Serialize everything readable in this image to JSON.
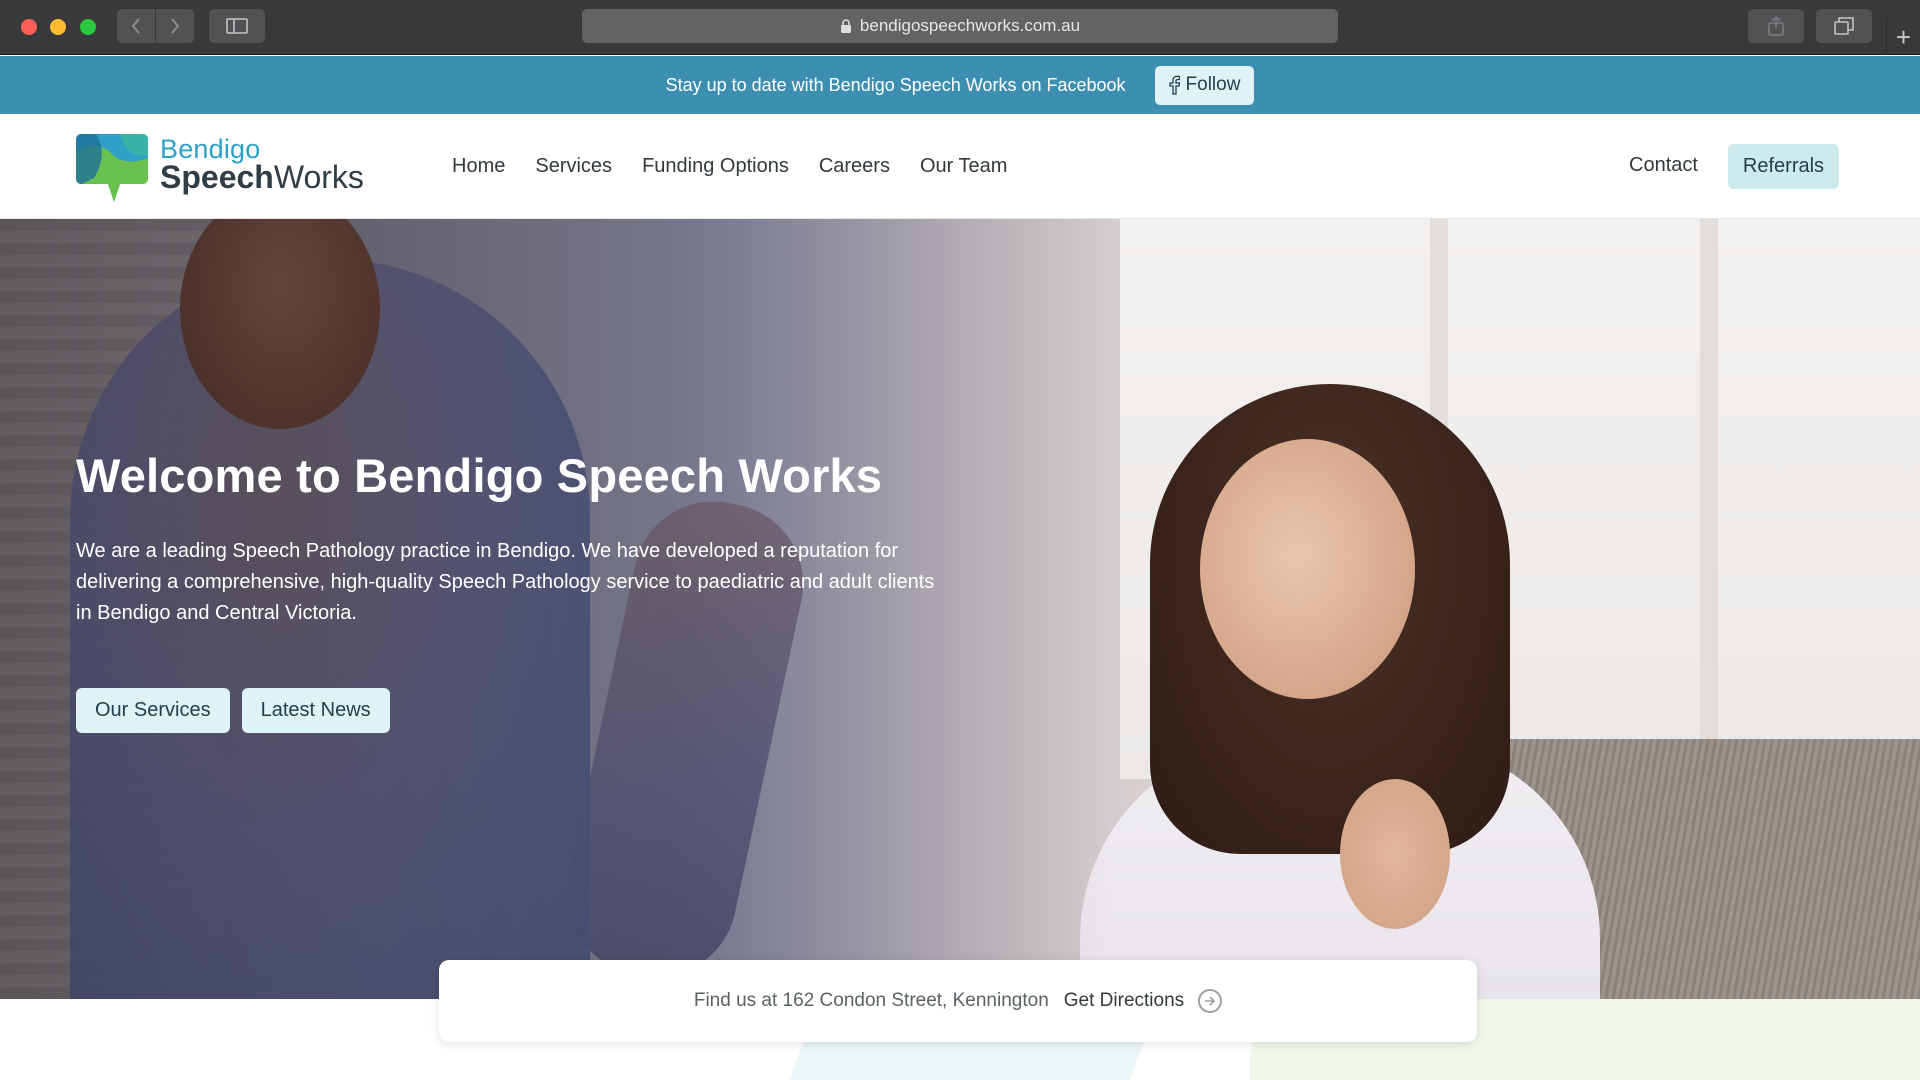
{
  "browser": {
    "url": "bendigospeechworks.com.au",
    "new_tab_glyph": "+"
  },
  "fb_banner": {
    "text": "Stay up to date with Bendigo Speech Works on Facebook",
    "follow_label": "Follow"
  },
  "header": {
    "logo_top": "Bendigo",
    "logo_bold": "Speech",
    "logo_rest": "Works",
    "nav": [
      "Home",
      "Services",
      "Funding Options",
      "Careers",
      "Our Team"
    ],
    "contact_label": "Contact",
    "referrals_label": "Referrals"
  },
  "hero": {
    "title": "Welcome to Bendigo Speech Works",
    "description": "We are a leading Speech Pathology practice in Bendigo. We have developed a reputation for delivering a comprehensive, high-quality Speech Pathology service to paediatric and adult clients in Bendigo and Central Victoria.",
    "buttons": [
      "Our Services",
      "Latest News"
    ]
  },
  "address_bar": {
    "text": "Find us at 162 Condon Street, Kennington",
    "directions_label": "Get Directions"
  },
  "colors": {
    "banner": "#3c8fb0",
    "button_light": "#dff2f5",
    "referrals": "#cdebee",
    "logo_blue": "#2fa1c8"
  },
  "icons": {
    "lock": "lock-icon",
    "facebook": "facebook-icon",
    "arrow": "arrow-right-circle-icon"
  }
}
